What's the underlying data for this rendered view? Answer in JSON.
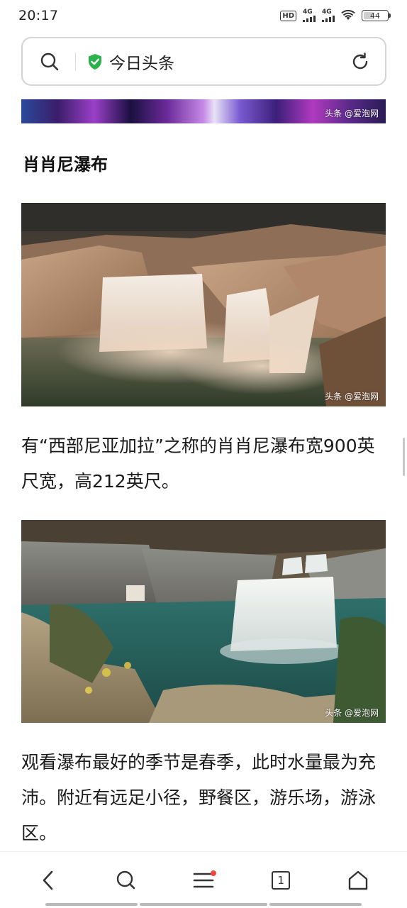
{
  "status": {
    "time": "20:17",
    "network1": "4G",
    "network2": "4G",
    "hd_label": "HD",
    "battery": "44",
    "battery_level": 0.44
  },
  "address_bar": {
    "site_title": "今日头条",
    "icons": [
      "search-icon",
      "verified-shield-icon",
      "refresh-icon"
    ],
    "shield_color": "#2bb34a"
  },
  "article": {
    "watermark": "头条 @爱泡网",
    "section_title": "肖肖尼瀑布",
    "paragraph1": "有“西部尼亚加拉”之称的肖肖尼瀑布宽900英尺宽，高212英尺。",
    "paragraph2": "观看瀑布最好的季节是春季，此时水量最为充沛。附近有远足小径，野餐区，游乐场，游泳区。"
  },
  "bottom_nav": {
    "items": [
      "back-icon",
      "search-icon",
      "menu-icon",
      "tabs-icon",
      "home-icon"
    ],
    "tab_count": "1",
    "notification_color": "#f0483e"
  }
}
